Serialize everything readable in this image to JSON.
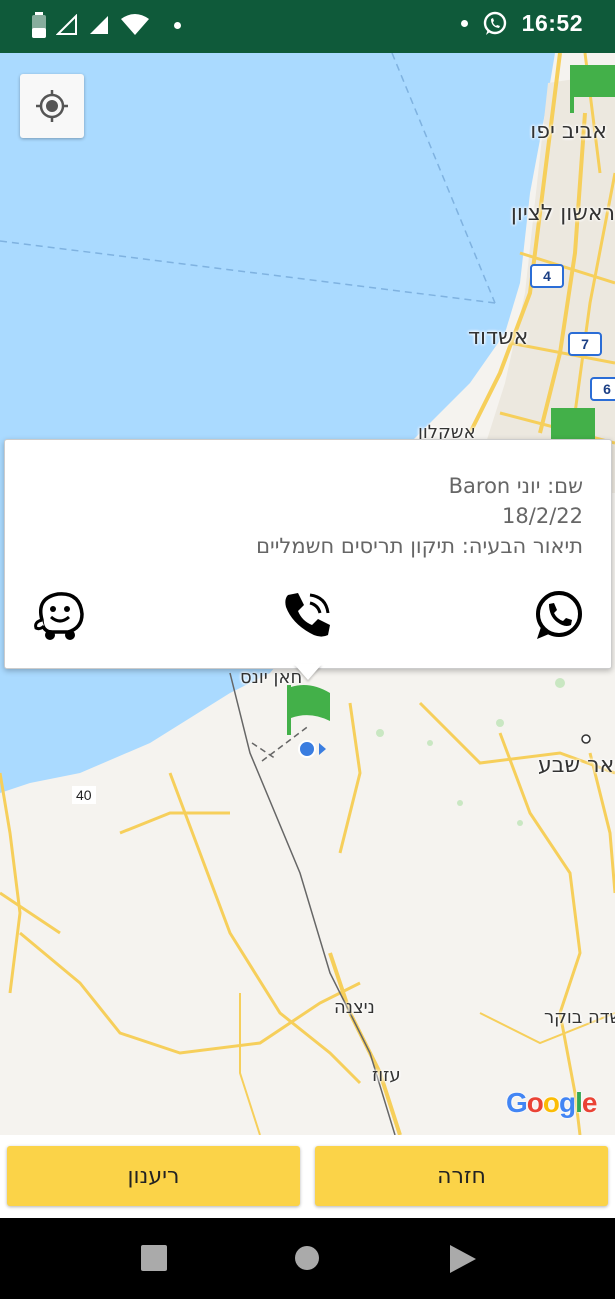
{
  "status_bar": {
    "time": "16:52",
    "background": "#0f5a3a"
  },
  "map": {
    "labels": {
      "tel_aviv": "אביב יפו",
      "rishon": "ראשון לציון",
      "ashdod": "אשדוד",
      "ashkelon": "אשקלון",
      "khan_yunis": "חאן יונס",
      "beer_sheva": "באר שבע",
      "nitzana": "ניצנה",
      "azuz": "עזוז",
      "sde_boker": "שדה בוקר"
    },
    "route_signs": {
      "r4": "4",
      "r7": "7",
      "r6": "6"
    },
    "road_number": "40",
    "google": {
      "G": "G",
      "o1": "o",
      "o2": "o",
      "g": "g",
      "l": "l",
      "e": "e"
    },
    "colors": {
      "sea": "#aadaff",
      "land": "#f5f3ef",
      "road": "#f6cf5b",
      "flag": "#43b049",
      "location": "#3a7de0"
    }
  },
  "card": {
    "name_line": "שם: יוני Baron",
    "date_line": "18/2/22",
    "desc_line": "תיאור הבעיה: תיקון תריסים חשמליים",
    "icons": [
      "waze-icon",
      "phone-call-icon",
      "whatsapp-icon"
    ]
  },
  "buttons": {
    "refresh": "ריענון",
    "back": "חזרה",
    "color": "#fbd348"
  }
}
